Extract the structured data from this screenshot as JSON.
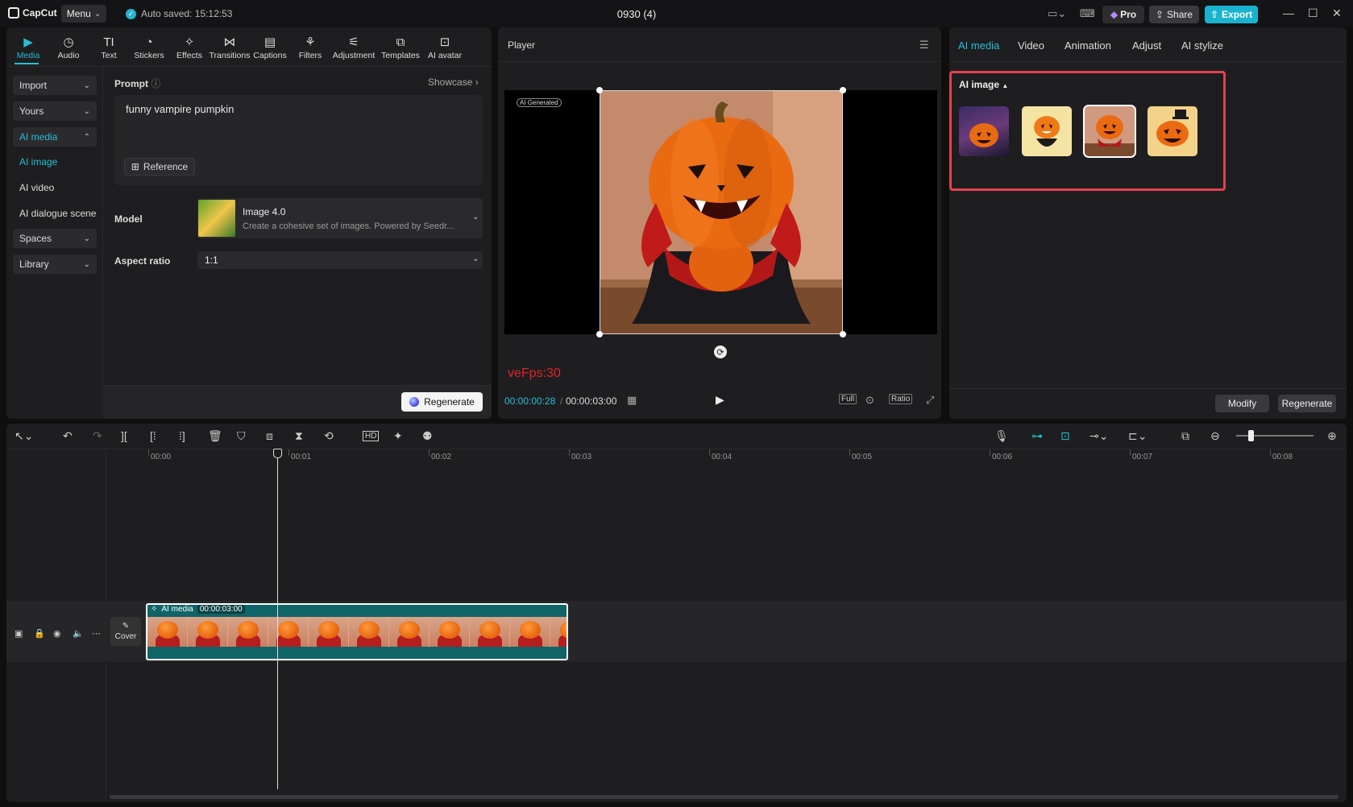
{
  "app": {
    "logo_text": "CapCut",
    "menu_label": "Menu",
    "autosave_text": "Auto saved: 15:12:53",
    "document_title": "0930 (4)",
    "pro_label": "Pro",
    "share_label": "Share",
    "export_label": "Export",
    "accent_color": "#27bdd6"
  },
  "toolbar": {
    "items": [
      {
        "label": "Media",
        "icon": "media-icon"
      },
      {
        "label": "Audio",
        "icon": "audio-icon"
      },
      {
        "label": "Text",
        "icon": "text-icon"
      },
      {
        "label": "Stickers",
        "icon": "sticker-icon"
      },
      {
        "label": "Effects",
        "icon": "effects-icon"
      },
      {
        "label": "Transitions",
        "icon": "transitions-icon"
      },
      {
        "label": "Captions",
        "icon": "captions-icon"
      },
      {
        "label": "Filters",
        "icon": "filters-icon"
      },
      {
        "label": "Adjustment",
        "icon": "adjustment-icon"
      },
      {
        "label": "Templates",
        "icon": "templates-icon"
      },
      {
        "label": "AI avatar",
        "icon": "ai-avatar-icon"
      }
    ],
    "active": "Media"
  },
  "sidebar": {
    "items": [
      {
        "label": "Import"
      },
      {
        "label": "Yours"
      },
      {
        "label": "AI media"
      },
      {
        "label": "AI image"
      },
      {
        "label": "AI video"
      },
      {
        "label": "AI dialogue scene"
      },
      {
        "label": "Spaces"
      },
      {
        "label": "Library"
      }
    ]
  },
  "form": {
    "prompt_label": "Prompt",
    "showcase_label": "Showcase",
    "prompt_value": "funny vampire pumpkin",
    "reference_label": "Reference",
    "model_label": "Model",
    "model_name": "Image 4.0",
    "model_desc": "Create a cohesive set of images. Powered by Seedr...",
    "aspect_label": "Aspect ratio",
    "aspect_value": "1:1",
    "regenerate_label": "Regenerate"
  },
  "player": {
    "title": "Player",
    "ai_badge": "AI Generated",
    "fps_text": "veFps:30",
    "current_time": "00:00:00:28",
    "total_time": "00:00:03:00",
    "full_label": "Full",
    "ratio_label": "Ratio"
  },
  "right_panel": {
    "tabs": [
      "AI media",
      "Video",
      "Animation",
      "Adjust",
      "AI stylize"
    ],
    "active_tab": "AI media",
    "section_label": "AI image",
    "selected_thumb": 2,
    "modify_label": "Modify",
    "regenerate_label": "Regenerate"
  },
  "timeline": {
    "ticks": [
      "00:00",
      "00:01",
      "00:02",
      "00:03",
      "00:04",
      "00:05",
      "00:06",
      "00:07",
      "00:08"
    ],
    "cover_label": "Cover",
    "clip_label": "AI media",
    "clip_duration": "00:00:03:00"
  }
}
